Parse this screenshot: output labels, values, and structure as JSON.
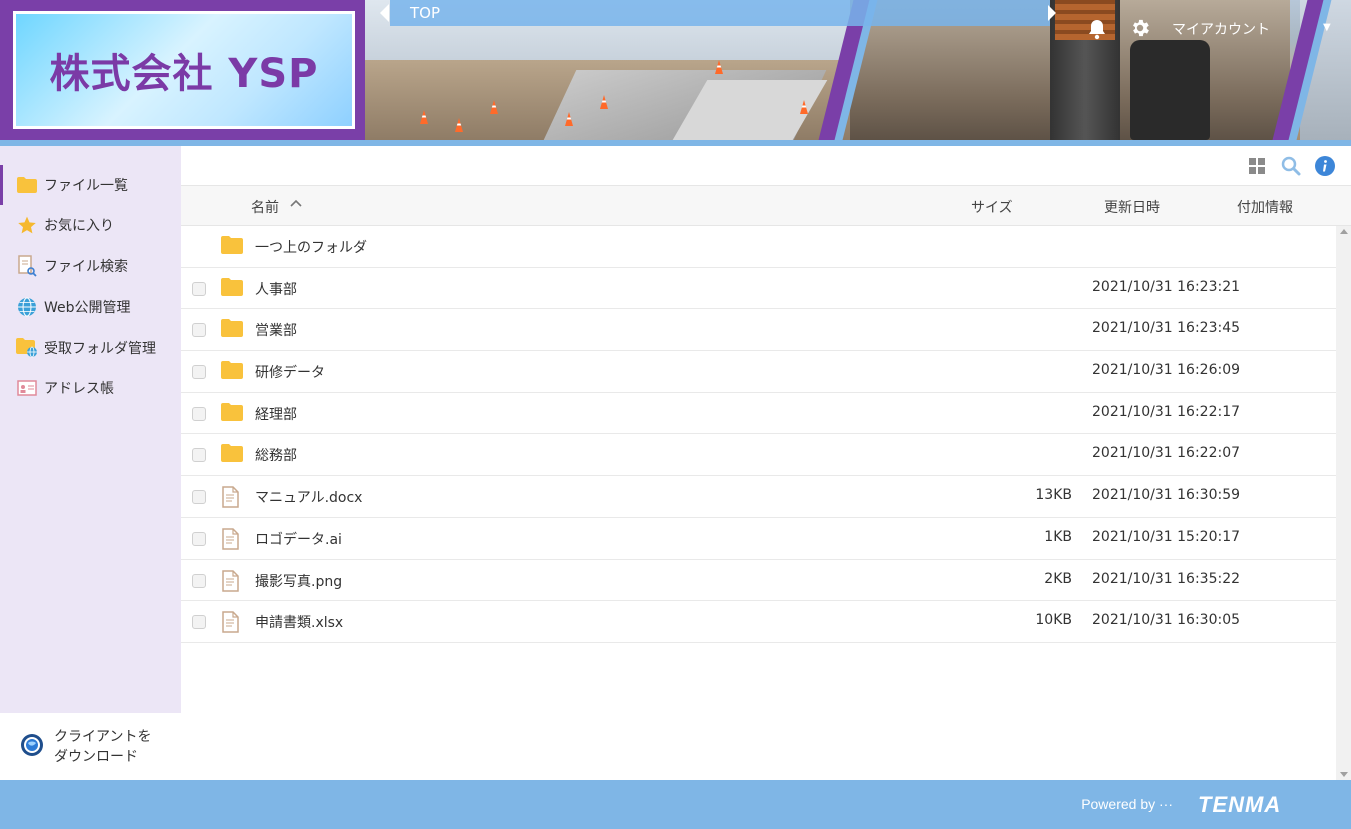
{
  "header": {
    "logo_text": "株式会社 YSP",
    "top_label": "TOP",
    "account_label": "マイアカウント",
    "colors": {
      "accent": "#7a3fa8",
      "header_blue": "#7fb6e6"
    }
  },
  "sidebar": {
    "items": [
      {
        "label": "ファイル一覧",
        "icon": "folder-icon",
        "active": true
      },
      {
        "label": "お気に入り",
        "icon": "star-icon",
        "active": false
      },
      {
        "label": "ファイル検索",
        "icon": "file-search-icon",
        "active": false
      },
      {
        "label": "Web公開管理",
        "icon": "globe-icon",
        "active": false
      },
      {
        "label": "受取フォルダ管理",
        "icon": "receive-folder-icon",
        "active": false
      },
      {
        "label": "アドレス帳",
        "icon": "address-book-icon",
        "active": false
      }
    ],
    "client_line1": "クライアントを",
    "client_line2": "ダウンロード"
  },
  "table": {
    "headers": {
      "name": "名前",
      "size": "サイズ",
      "updated": "更新日時",
      "extra": "付加情報"
    },
    "rows": [
      {
        "type": "parent",
        "name": "一つ上のフォルダ",
        "size": "",
        "updated": ""
      },
      {
        "type": "folder",
        "name": "人事部",
        "size": "",
        "updated": "2021/10/31 16:23:21"
      },
      {
        "type": "folder",
        "name": "営業部",
        "size": "",
        "updated": "2021/10/31 16:23:45"
      },
      {
        "type": "folder",
        "name": "研修データ",
        "size": "",
        "updated": "2021/10/31 16:26:09"
      },
      {
        "type": "folder",
        "name": "経理部",
        "size": "",
        "updated": "2021/10/31 16:22:17"
      },
      {
        "type": "folder",
        "name": "総務部",
        "size": "",
        "updated": "2021/10/31 16:22:07"
      },
      {
        "type": "file",
        "name": "マニュアル.docx",
        "size": "13KB",
        "updated": "2021/10/31 16:30:59"
      },
      {
        "type": "file",
        "name": "ロゴデータ.ai",
        "size": "1KB",
        "updated": "2021/10/31 15:20:17"
      },
      {
        "type": "file",
        "name": "撮影写真.png",
        "size": "2KB",
        "updated": "2021/10/31 16:35:22"
      },
      {
        "type": "file",
        "name": "申請書類.xlsx",
        "size": "10KB",
        "updated": "2021/10/31 16:30:05"
      }
    ]
  },
  "footer": {
    "powered_by": "Powered by ···",
    "brand": "TENMA"
  }
}
